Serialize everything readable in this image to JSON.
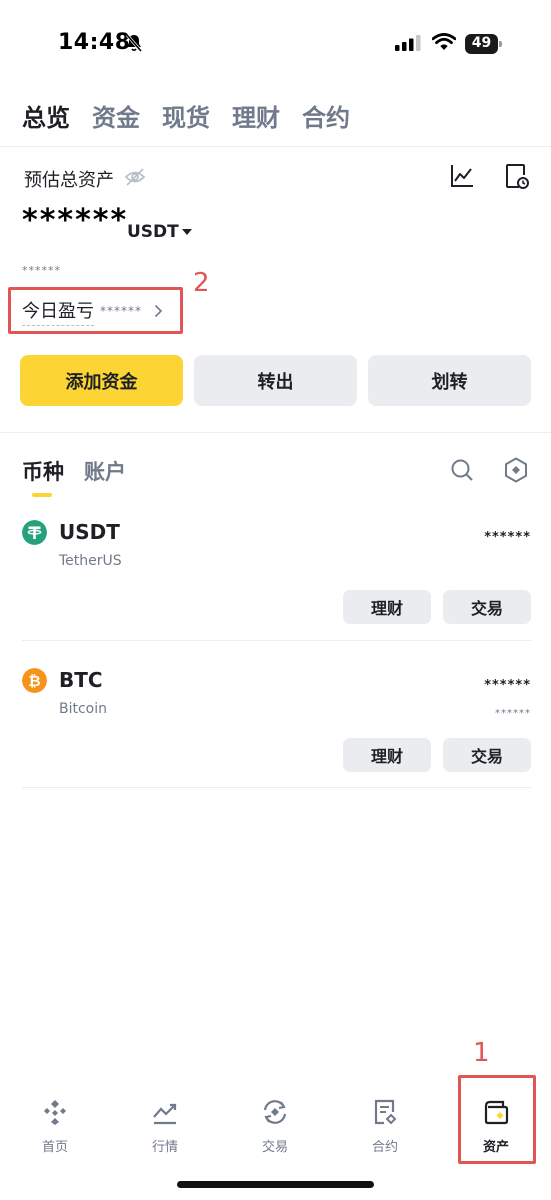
{
  "status_bar": {
    "time": "14:48",
    "battery": "49"
  },
  "top_tabs": [
    {
      "label": "总览",
      "active": true
    },
    {
      "label": "资金",
      "active": false
    },
    {
      "label": "现货",
      "active": false
    },
    {
      "label": "理财",
      "active": false
    },
    {
      "label": "合约",
      "active": false
    }
  ],
  "overview": {
    "estimated_label": "预估总资产",
    "total_value": "******",
    "currency": "USDT",
    "fiat_value": "******",
    "pnl_label": "今日盈亏",
    "pnl_value": "******"
  },
  "actions": {
    "deposit": "添加资金",
    "withdraw": "转出",
    "transfer": "划转"
  },
  "coin_tabs": [
    {
      "label": "币种",
      "active": true
    },
    {
      "label": "账户",
      "active": false
    }
  ],
  "assets": [
    {
      "symbol": "USDT",
      "name": "TetherUS",
      "amount": "******",
      "value": "",
      "earn_label": "理财",
      "trade_label": "交易",
      "icon_color": "#26a17b"
    },
    {
      "symbol": "BTC",
      "name": "Bitcoin",
      "amount": "******",
      "value": "******",
      "earn_label": "理财",
      "trade_label": "交易",
      "icon_color": "#f7931a"
    }
  ],
  "bottom_nav": [
    {
      "label": "首页",
      "icon": "home-icon",
      "active": false
    },
    {
      "label": "行情",
      "icon": "markets-icon",
      "active": false
    },
    {
      "label": "交易",
      "icon": "trade-icon",
      "active": false
    },
    {
      "label": "合约",
      "icon": "futures-icon",
      "active": false
    },
    {
      "label": "资产",
      "icon": "wallet-icon",
      "active": true
    }
  ],
  "annotations": {
    "marker_1": "1",
    "marker_2": "2"
  },
  "colors": {
    "accent": "#fcd535",
    "annotation": "#e25555",
    "text": "#1e2026",
    "muted": "#707a8a"
  }
}
